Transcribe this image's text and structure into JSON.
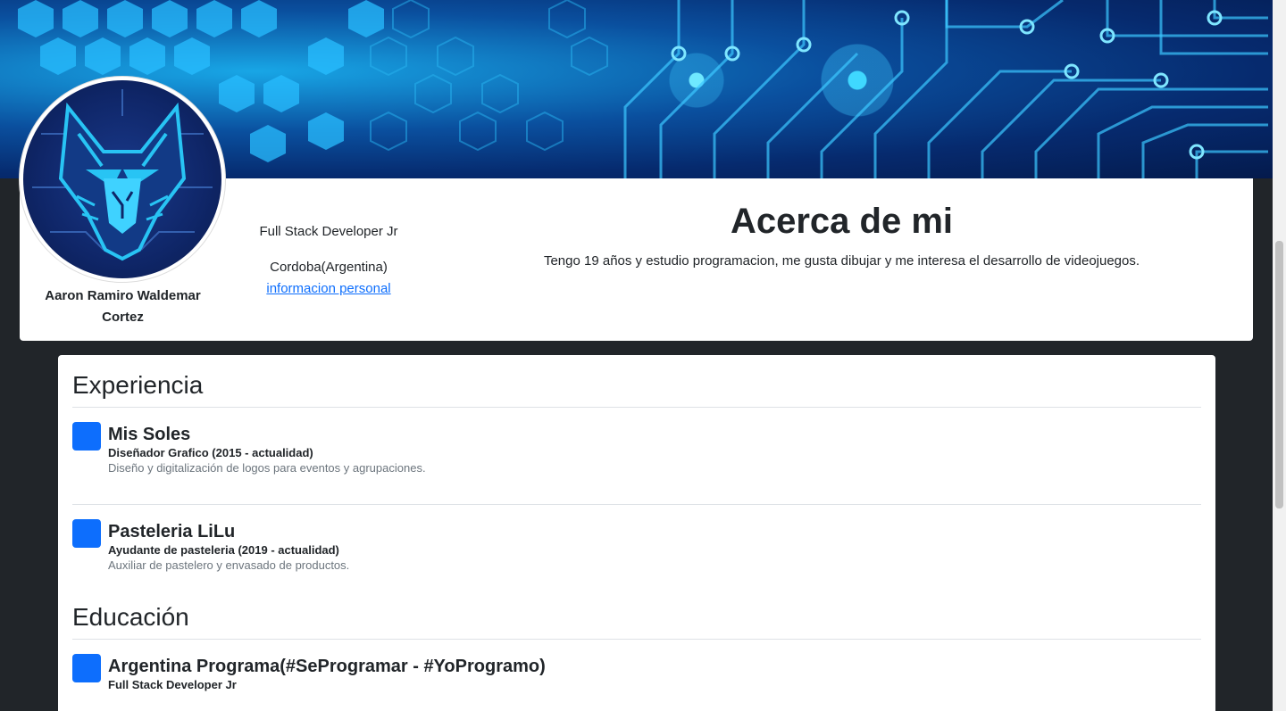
{
  "profile": {
    "name": "Aaron Ramiro Waldemar Cortez",
    "role": "Full Stack Developer Jr",
    "location": "Cordoba(Argentina)",
    "personal_link": "informacion personal"
  },
  "about": {
    "title": "Acerca de mi",
    "text": "Tengo 19 años y estudio programacion, me gusta dibujar y me interesa el desarrollo de videojuegos."
  },
  "experience": {
    "title": "Experiencia",
    "items": [
      {
        "company": "Mis Soles",
        "position": "Diseñador Grafico (2015 - actualidad)",
        "description": "Diseño y digitalización de logos para eventos y agrupaciones."
      },
      {
        "company": "Pasteleria LiLu",
        "position": "Ayudante de pasteleria (2019 - actualidad)",
        "description": "Auxiliar de pastelero y envasado de productos."
      }
    ]
  },
  "education": {
    "title": "Educación",
    "items": [
      {
        "institution": "Argentina Programa(#SeProgramar - #YoProgramo)",
        "degree": "Full Stack Developer Jr"
      }
    ]
  },
  "colors": {
    "accent": "#0d6efd",
    "page_background": "#212529",
    "card_background": "#ffffff"
  }
}
